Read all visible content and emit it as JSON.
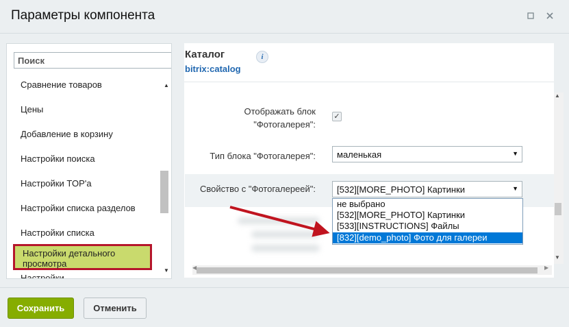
{
  "dialog": {
    "title": "Параметры компонента",
    "header_icons": [
      "restore-icon",
      "close-icon"
    ]
  },
  "sidebar": {
    "search_placeholder": "Поиск",
    "items": [
      {
        "label": "Сравнение товаров"
      },
      {
        "label": "Цены"
      },
      {
        "label": "Добавление в корзину"
      },
      {
        "label": "Настройки поиска"
      },
      {
        "label": "Настройки TOP'а"
      },
      {
        "label": "Настройки списка разделов"
      },
      {
        "label": "Настройки списка"
      },
      {
        "label": "Настройки детального просмотра"
      },
      {
        "label": "Настройки"
      }
    ],
    "active_index": 7
  },
  "component": {
    "title": "Каталог",
    "code": "bitrix:catalog",
    "info_icon": "i"
  },
  "form": {
    "show_gallery_label": "Отображать блок \"Фотогалерея\":",
    "show_gallery_checked": true,
    "checkmark": "✓",
    "gallery_type_label": "Тип блока \"Фотогалерея\":",
    "gallery_type_value": "маленькая",
    "gallery_prop_label": "Свойство с \"Фотогалереей\":",
    "gallery_prop_value": "[532][MORE_PHOTO] Картинки",
    "dropdown_options": [
      "не выбрано",
      "[532][MORE_PHOTO] Картинки",
      "[533][INSTRUCTIONS] Файлы",
      "[832][demo_photo] Фото для галереи"
    ],
    "dropdown_selected_index": 3
  },
  "annotation": {
    "arrow_color": "#c0141f"
  },
  "footer": {
    "save_label": "Сохранить",
    "cancel_label": "Отменить"
  },
  "colors": {
    "save_button": "#86ad00",
    "active_item_bg": "#c9da6d",
    "active_item_border": "#b5152b",
    "link": "#2067b0",
    "selected_option": "#0078d7"
  }
}
